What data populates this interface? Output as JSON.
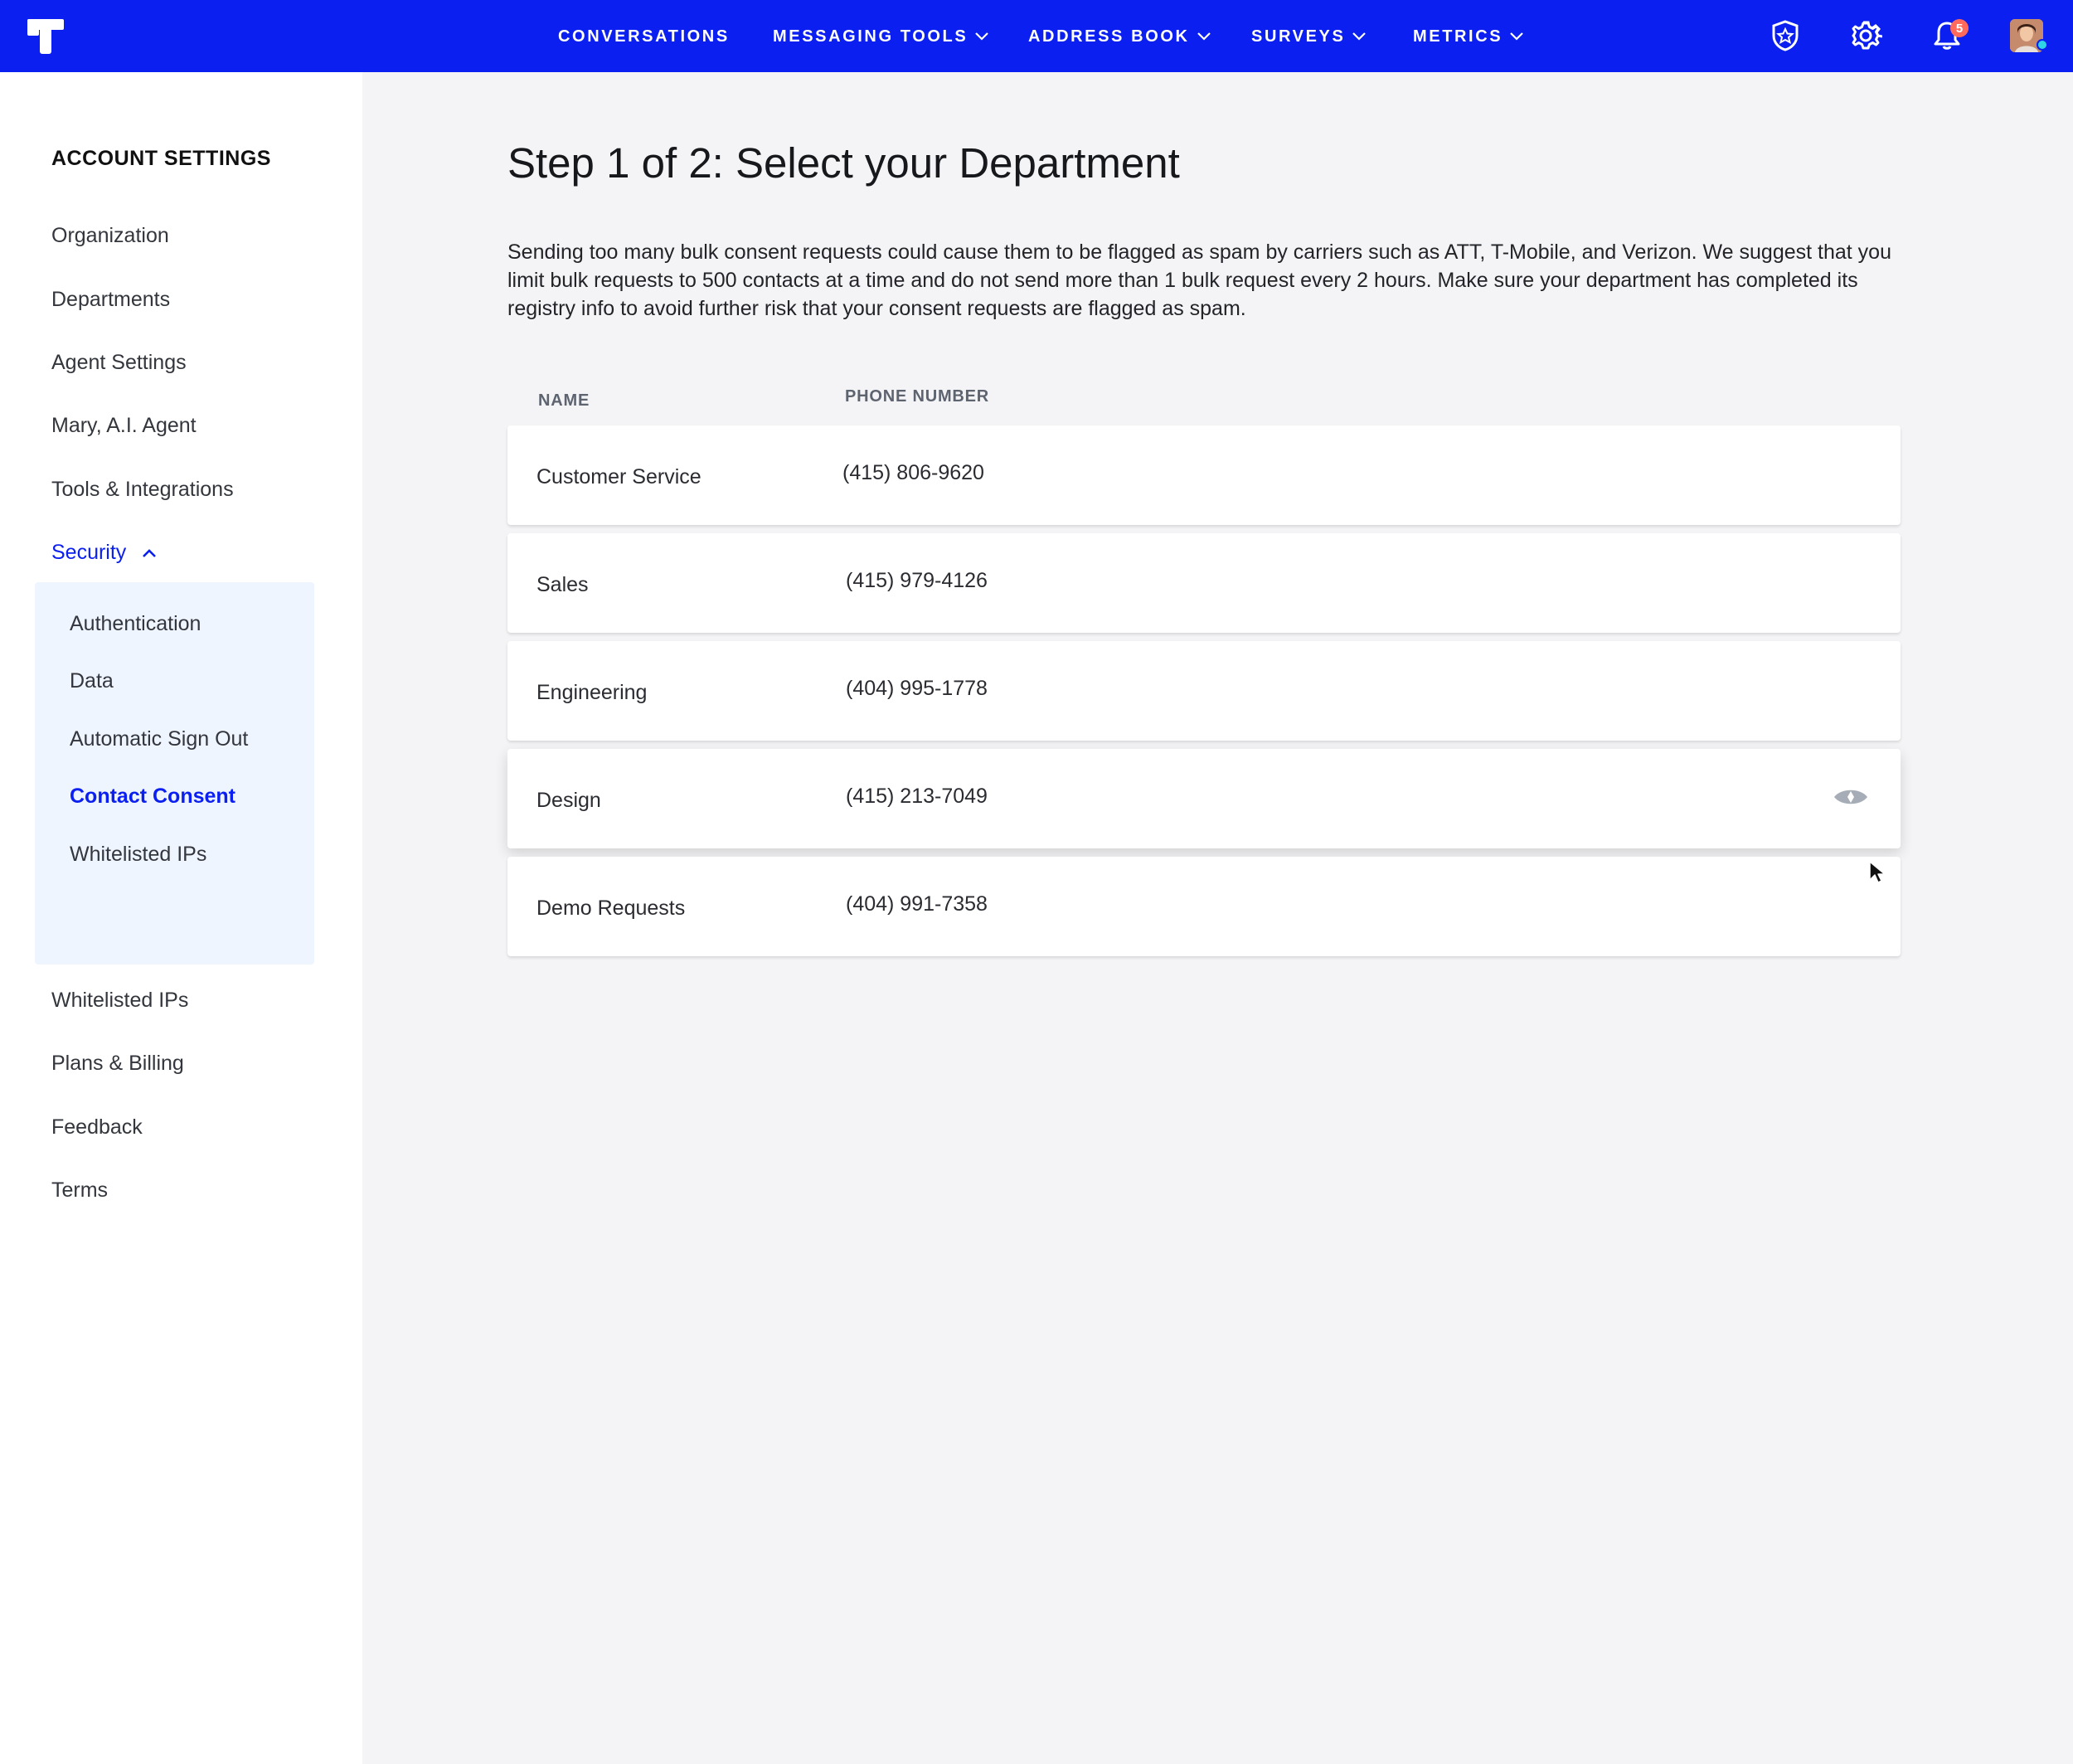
{
  "nav": {
    "items": [
      {
        "label": "CONVERSATIONS",
        "dropdown": false
      },
      {
        "label": "MESSAGING TOOLS",
        "dropdown": true
      },
      {
        "label": "ADDRESS BOOK",
        "dropdown": true
      },
      {
        "label": "SURVEYS",
        "dropdown": true
      },
      {
        "label": "METRICS",
        "dropdown": true
      }
    ],
    "icons": [
      "shield-star-icon",
      "gear-icon",
      "bell-icon",
      "avatar"
    ],
    "notification_count": "5",
    "brand_color": "#0a1ff0",
    "badge_color": "#ff6a5c",
    "online_color": "#2fd3e6"
  },
  "sidebar": {
    "heading": "ACCOUNT SETTINGS",
    "items": [
      {
        "label": "Organization"
      },
      {
        "label": "Departments"
      },
      {
        "label": "Agent Settings"
      },
      {
        "label": "Mary, A.I. Agent"
      },
      {
        "label": "Tools & Integrations"
      },
      {
        "label": "Security",
        "expanded": true
      },
      {
        "label": "Whitelisted IPs"
      },
      {
        "label": "Plans & Billing"
      },
      {
        "label": "Feedback"
      },
      {
        "label": "Terms"
      }
    ],
    "security_subitems": [
      {
        "label": "Authentication"
      },
      {
        "label": "Data"
      },
      {
        "label": "Automatic Sign Out"
      },
      {
        "label": "Contact Consent",
        "current": true
      },
      {
        "label": "Whitelisted IPs"
      }
    ]
  },
  "main": {
    "title": "Step 1 of 2: Select your Department",
    "description": "Sending too many bulk consent requests could cause them to be flagged as spam by carriers such as ATT, T-Mobile, and Verizon. We suggest that you limit bulk requests to 500 contacts at a time and do not send more than 1 bulk request every 2 hours. Make sure your department has completed its registry info to avoid further risk that your consent requests are flagged as spam.",
    "columns": {
      "name": "NAME",
      "phone": "PHONE NUMBER"
    },
    "departments": [
      {
        "name": "Customer Service",
        "phone": "(415) 806-9620"
      },
      {
        "name": "Sales",
        "phone": "(415) 979-4126"
      },
      {
        "name": "Engineering",
        "phone": "(404) 995-1778"
      },
      {
        "name": "Design",
        "phone": "(415) 213-7049",
        "hovered": true,
        "icon": "eye-icon"
      },
      {
        "name": "Demo Requests",
        "phone": "(404) 991-7358"
      }
    ]
  }
}
